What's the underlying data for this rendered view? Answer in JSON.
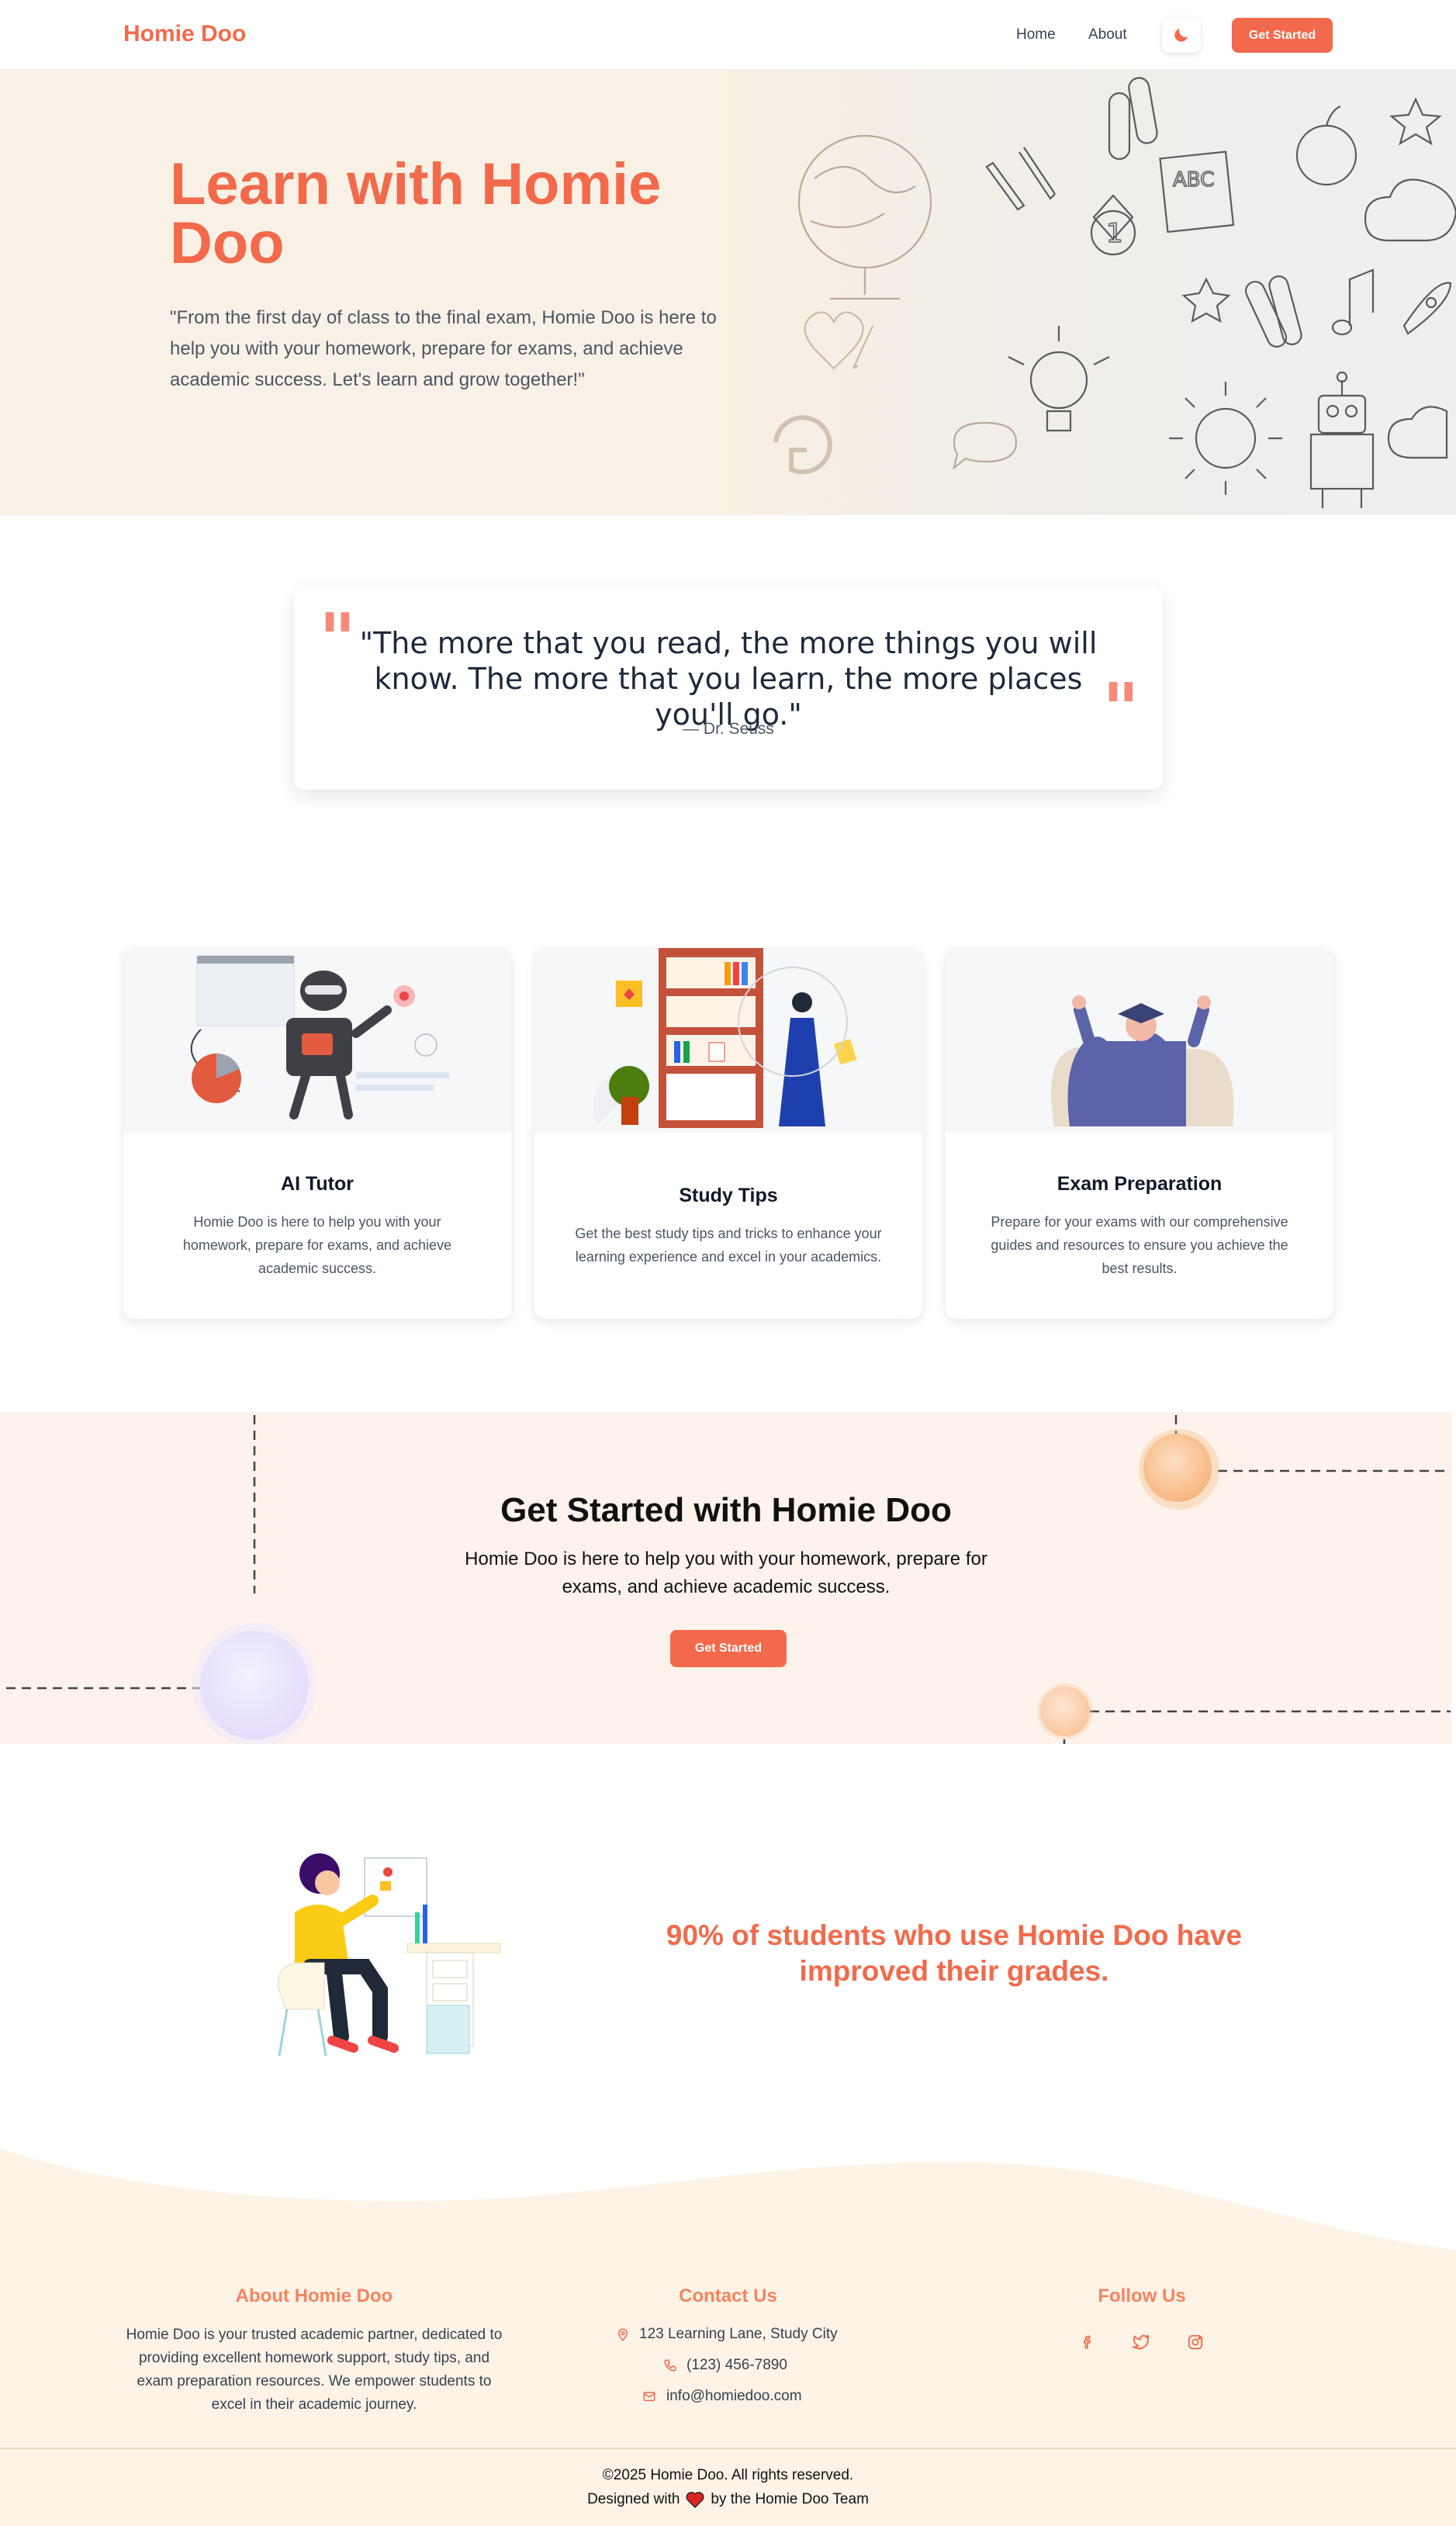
{
  "nav": {
    "logo": "Homie Doo",
    "links": [
      "Home",
      "About"
    ],
    "theme_icon": "moon-icon",
    "cta_label": "Get Started"
  },
  "hero": {
    "title": "Learn with Homie Doo",
    "text": "\"From the first day of class to the final exam, Homie Doo is here to help you with your homework, prepare for exams, and achieve academic success. Let's learn and grow together!\""
  },
  "quote": {
    "text": "\"The more that you read, the more things you will know. The more that you learn, the more places you'll go.\"",
    "author": "— Dr. Seuss"
  },
  "features": [
    {
      "title": "AI Tutor",
      "text": "Homie Doo is here to help you with your homework, prepare for exams, and achieve academic success."
    },
    {
      "title": "Study Tips",
      "text": "Get the best study tips and tricks to enhance your learning experience and excel in your academics."
    },
    {
      "title": "Exam Preparation",
      "text": "Prepare for your exams with our comprehensive guides and resources to ensure you achieve the best results."
    }
  ],
  "cta": {
    "title": "Get Started with Homie Doo",
    "text": "Homie Doo is here to help you with your homework, prepare for exams, and achieve academic success.",
    "button": "Get Started"
  },
  "stat": {
    "text": "90% of students who use Homie Doo have improved their grades."
  },
  "footer": {
    "about_title": "About Homie Doo",
    "about_text": "Homie Doo is your trusted academic partner, dedicated to providing excellent homework support, study tips, and exam preparation resources. We empower students to excel in their academic journey.",
    "contact_title": "Contact Us",
    "address": "123 Learning Lane, Study City",
    "phone": "(123) 456-7890",
    "email": "info@homiedoo.com",
    "follow_title": "Follow Us",
    "social_icons": [
      "facebook-icon",
      "twitter-icon",
      "instagram-icon"
    ],
    "copyright": "©2025 Homie Doo. All rights reserved.",
    "designed_prefix": "Designed with",
    "designed_suffix": "by the Homie Doo Team"
  },
  "colors": {
    "accent": "#f26a4b",
    "hero_bg": "#faf1e6",
    "cta_bg": "#fdf3ec",
    "footer_bg": "#fdf3e6"
  }
}
